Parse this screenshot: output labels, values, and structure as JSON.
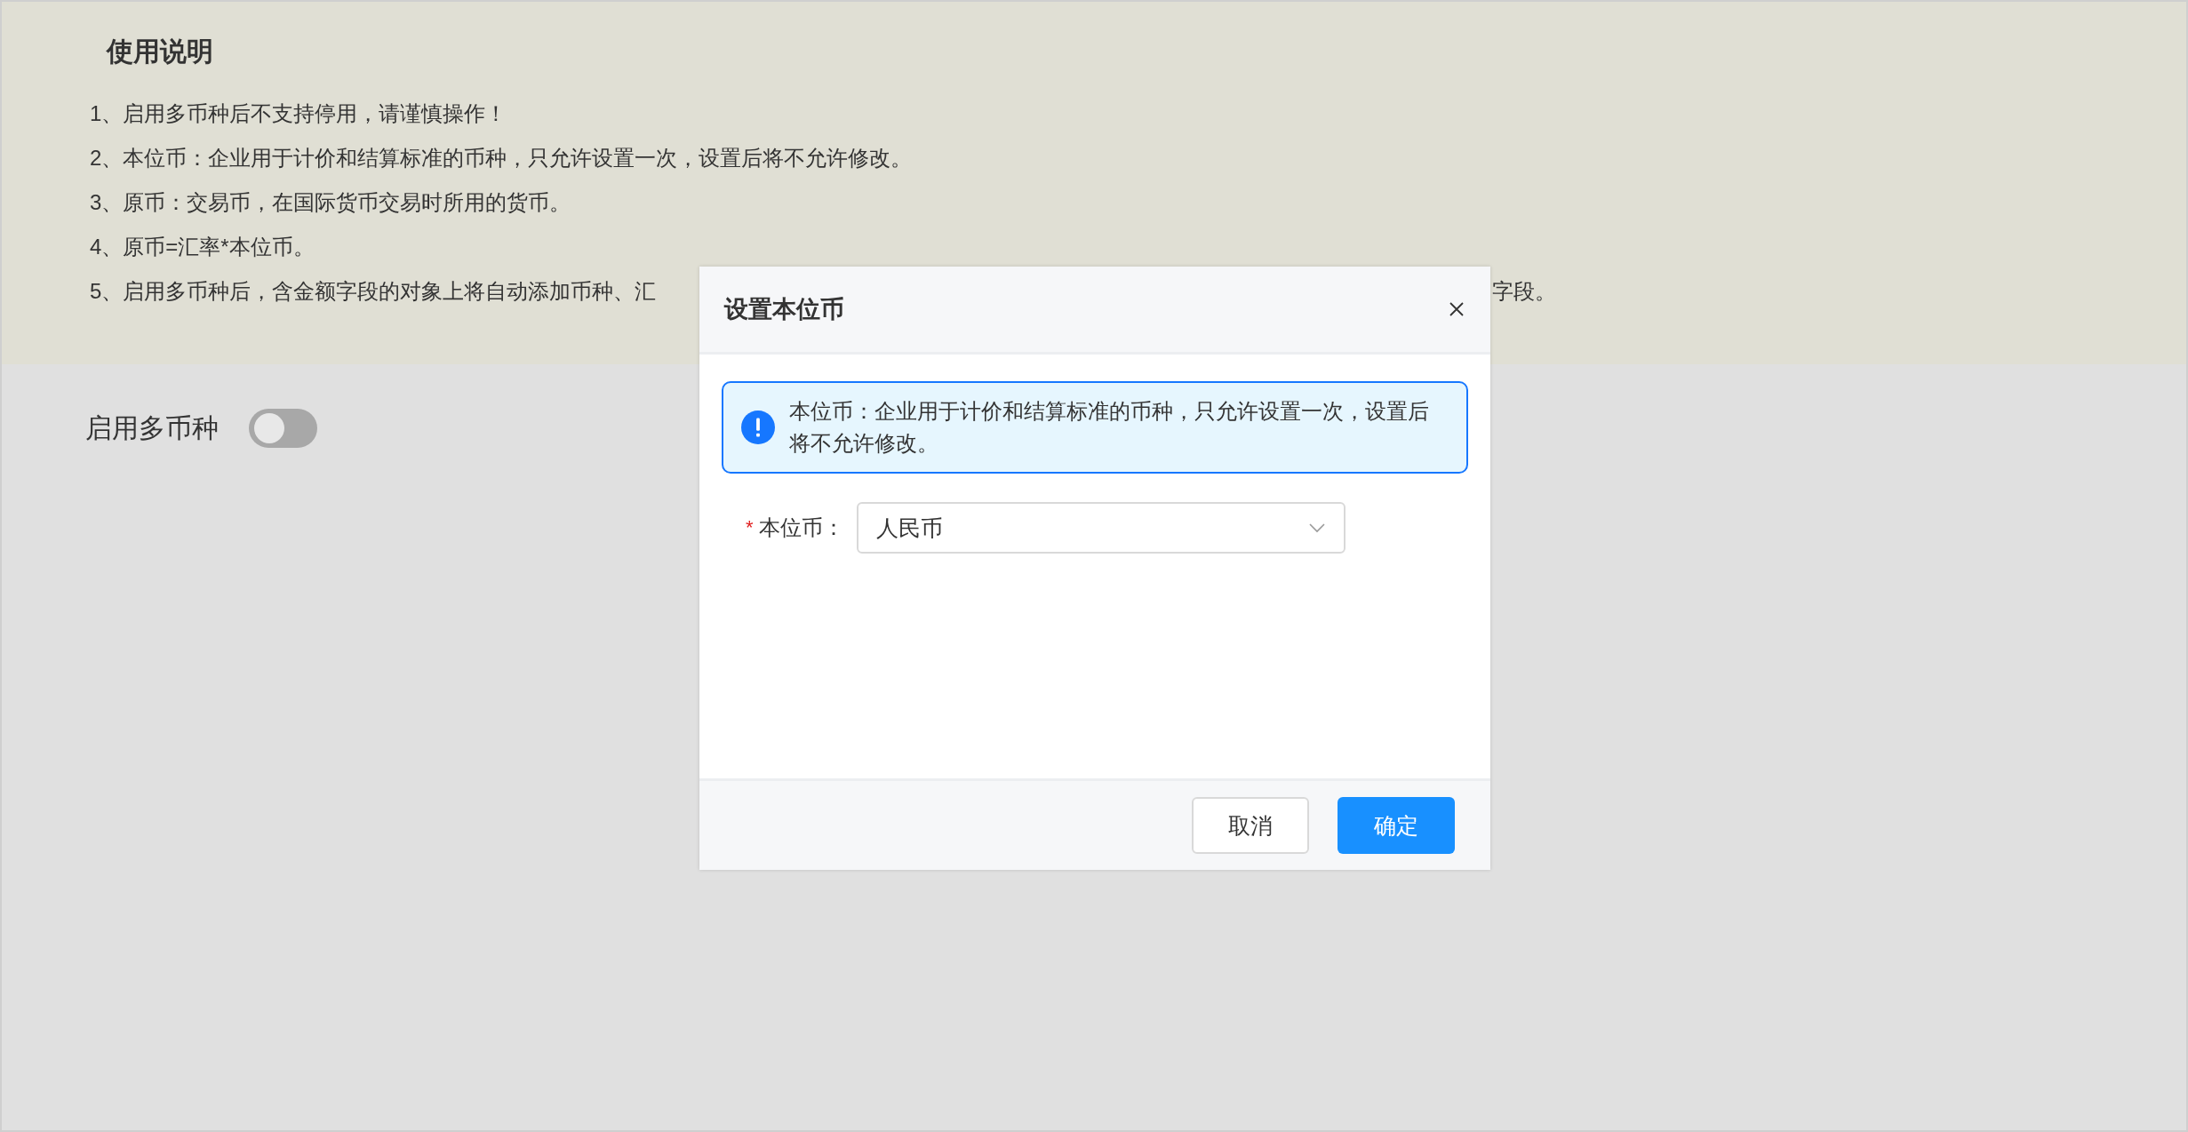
{
  "notes": {
    "title": "使用说明",
    "items": [
      {
        "text": "1、启用多币种后不支持停用，请谨慎操作！"
      },
      {
        "text": "2、本位币：企业用于计价和结算标准的币种，只允许设置一次，设置后将不允许修改。"
      },
      {
        "text": "3、原币：交易币，在国际货币交易时所用的货币。"
      },
      {
        "text": "4、原币=汇率*本位币。"
      },
      {
        "text": "5、启用多币种后，含金额字段的对象上将自动添加币种、汇",
        "continued": "字段。"
      }
    ]
  },
  "toggle": {
    "label": "启用多币种",
    "on": false
  },
  "dialog": {
    "title": "设置本位币",
    "alert": "本位币：企业用于计价和结算标准的币种，只允许设置一次，设置后将不允许修改。",
    "field": {
      "label": "本位币：",
      "required_mark": "*",
      "value": "人民币"
    },
    "buttons": [
      {
        "label": "取消",
        "kind": "default"
      },
      {
        "label": "确定",
        "kind": "primary"
      }
    ]
  }
}
